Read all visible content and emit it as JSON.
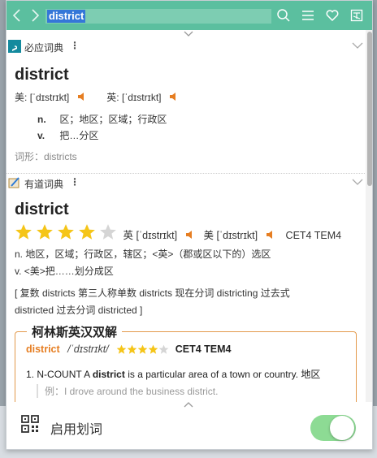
{
  "search": {
    "value": "district"
  },
  "bing": {
    "name": "必应词典",
    "word": "district",
    "us_label": "美:",
    "us_phonetic": "[ˈdɪstrɪkt]",
    "uk_label": "英:",
    "uk_phonetic": "[ˈdɪstrɪkt]",
    "defs": [
      {
        "pos": "n.",
        "text": "区；地区；区域；行政区"
      },
      {
        "pos": "v.",
        "text": "把…分区"
      }
    ],
    "forms": "词形：districts"
  },
  "youdao": {
    "name": "有道词典",
    "word": "district",
    "rating": 4,
    "uk_label": "英",
    "uk_phonetic": "[ˈdɪstrɪkt]",
    "us_label": "美",
    "us_phonetic": "[ˈdɪstrɪkt]",
    "tags": "CET4 TEM4",
    "def_n": "n. 地区，区域；行政区，辖区；<英>（郡或区以下的）选区",
    "def_v": "v. <美>把……划分成区",
    "forms_line1": "[ 复数 districts 第三人称单数 districts 现在分词 districting 过去式",
    "forms_line2": "districted 过去分词 districted ]"
  },
  "collins": {
    "title": "柯林斯英汉双解",
    "word": "district",
    "phonetic": "/ˈdɪstrɪkt/",
    "rating": 4,
    "tags": "CET4 TEM4",
    "sense_num": "1.",
    "sense_pre": "N-COUNT A",
    "sense_word": "district",
    "sense_post": "is a particular area of a town or country. 地区",
    "example": "例：I drove around the business district."
  },
  "footer": {
    "label": "启用划词",
    "toggle_on": true
  },
  "colors": {
    "topbar": "#5bbf9f",
    "accent": "#e67e22",
    "star": "#f5c518",
    "toggle": "#8ddb94"
  }
}
